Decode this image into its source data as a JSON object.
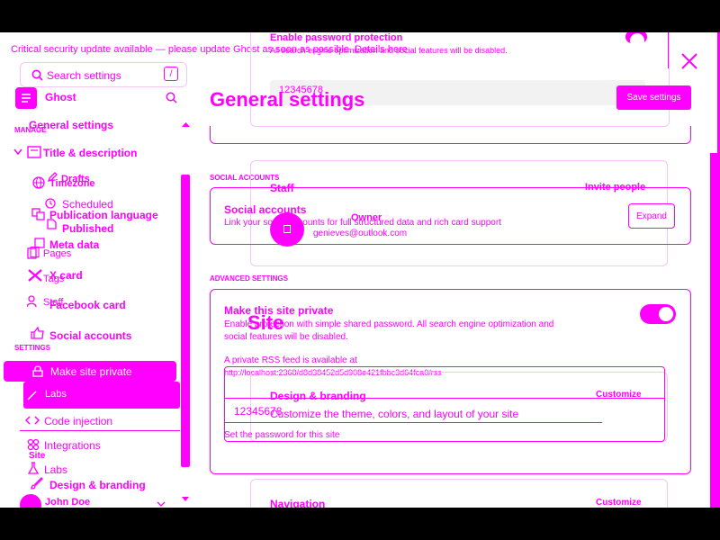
{
  "banner": {
    "text": "Critical security update available — please update Ghost as soon as possible. Details here"
  },
  "sidebar": {
    "search_placeholder": "Search settings",
    "shortcut_key": "/",
    "brand": "Ghost",
    "general_settings_label": "General settings",
    "manage_header": "MANAGE",
    "title_desc": "Title & description",
    "drafts": "Drafts",
    "timezone": "Timezone",
    "scheduled": "Scheduled",
    "publication_language": "Publication language",
    "published": "Published",
    "meta_data": "Meta data",
    "pages": "Pages",
    "x_card": "X card",
    "tags": "Tags",
    "facebook_card": "Facebook card",
    "staff": "Staff",
    "social_accounts": "Social accounts",
    "settings_header": "SETTINGS",
    "make_site_private": "Make site private",
    "labs_dup": "Labs",
    "code_injection": "Code injection",
    "integrations": "Integrations",
    "site": "Site",
    "labs": "Labs",
    "design_branding": "Design & branding",
    "user_name": "John Doe"
  },
  "main": {
    "title": "General settings",
    "save_button": "Save settings",
    "password_value": "12345678",
    "top_modal": {
      "title": "Enable password protection",
      "desc": "All search engine optimization and social features will be disabled."
    },
    "social_header": "SOCIAL ACCOUNTS",
    "social_title": "Social accounts",
    "social_desc": "Link your social accounts for full structured data and rich card support",
    "expand_button": "Expand",
    "staff": {
      "title": "Staff",
      "invite": "Invite people",
      "user_name": "Owner",
      "user_email": "genieves@outlook.com"
    },
    "advanced_header": "ADVANCED SETTINGS",
    "private": {
      "title": "Make this site private",
      "desc_line1": "Enable protection with simple shared password. All search engine optimization and",
      "desc_line2": "social features will be disabled.",
      "rss_label": "A private RSS feed is available at",
      "rss_url": "http://localhost:2368/d8d38452d5d908e421fbbc3d64fca0/rss",
      "password": "12345678",
      "hint": "Set the password for this site"
    },
    "site_overlay": {
      "site_label": "Site",
      "design_title": "Design & branding",
      "design_customize": "Customize",
      "design_desc": "Customize the theme, colors, and layout of your site",
      "navigation_title": "Navigation",
      "navigation_customize": "Customize"
    }
  },
  "colors": {
    "accent": "#ff00ff",
    "background": "#ffffff",
    "frame": "#000000"
  }
}
